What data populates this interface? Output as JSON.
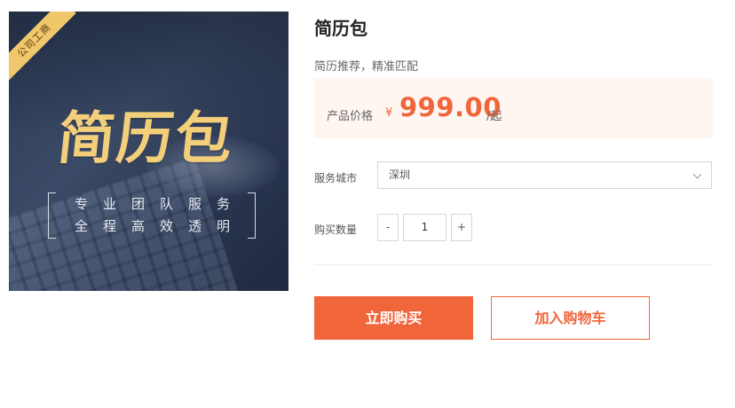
{
  "image": {
    "ribbon": "公司工商",
    "hero_title": "简历包",
    "tag_line_1": "专业团队服务",
    "tag_line_2": "全程高效透明"
  },
  "product": {
    "title": "简历包",
    "subtitle": "简历推荐，精准匹配"
  },
  "price": {
    "label": "产品价格",
    "currency": "¥",
    "amount": "999.00",
    "unit": "/起"
  },
  "city": {
    "label": "服务城市",
    "selected": "深圳"
  },
  "quantity": {
    "label": "购买数量",
    "minus": "-",
    "value": "1",
    "plus": "+"
  },
  "actions": {
    "buy": "立即购买",
    "add_to_cart": "加入购物车"
  },
  "colors": {
    "accent": "#f1653b",
    "price_bg": "#fff6f1",
    "hero_gold": "#f3cf7a"
  }
}
